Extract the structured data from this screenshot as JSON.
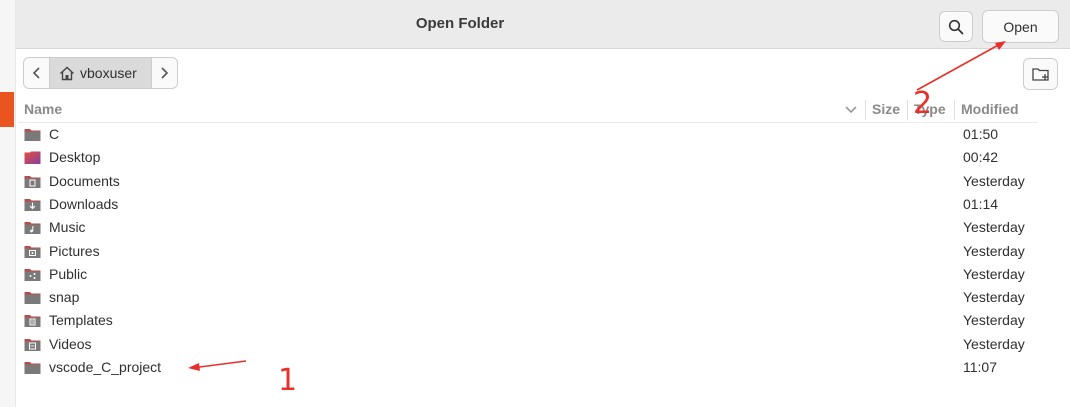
{
  "dialog": {
    "title": "Open Folder"
  },
  "header": {
    "open_label": "Open",
    "search_icon": "search-icon"
  },
  "pathbar": {
    "crumb": "vboxuser",
    "home_icon": "home-icon"
  },
  "columns": {
    "name": "Name",
    "size": "Size",
    "type": "Type",
    "modified": "Modified"
  },
  "files": [
    {
      "name": "C",
      "modified": "01:50",
      "icon": "folder-icon"
    },
    {
      "name": "Desktop",
      "modified": "00:42",
      "icon": "desktop-folder-icon"
    },
    {
      "name": "Documents",
      "modified": "Yesterday",
      "icon": "documents-folder-icon"
    },
    {
      "name": "Downloads",
      "modified": "01:14",
      "icon": "downloads-folder-icon"
    },
    {
      "name": "Music",
      "modified": "Yesterday",
      "icon": "music-folder-icon"
    },
    {
      "name": "Pictures",
      "modified": "Yesterday",
      "icon": "pictures-folder-icon"
    },
    {
      "name": "Public",
      "modified": "Yesterday",
      "icon": "public-folder-icon"
    },
    {
      "name": "snap",
      "modified": "Yesterday",
      "icon": "folder-icon"
    },
    {
      "name": "Templates",
      "modified": "Yesterday",
      "icon": "templates-folder-icon"
    },
    {
      "name": "Videos",
      "modified": "Yesterday",
      "icon": "videos-folder-icon"
    },
    {
      "name": "vscode_C_project",
      "modified": "11:07",
      "icon": "folder-icon"
    }
  ],
  "annotations": {
    "label1": "1",
    "label2": "2",
    "color": "#e8302a"
  },
  "colors": {
    "accent": "#e95420",
    "folder": "#7a7a7a",
    "folder_tab": "#b94b4b"
  }
}
